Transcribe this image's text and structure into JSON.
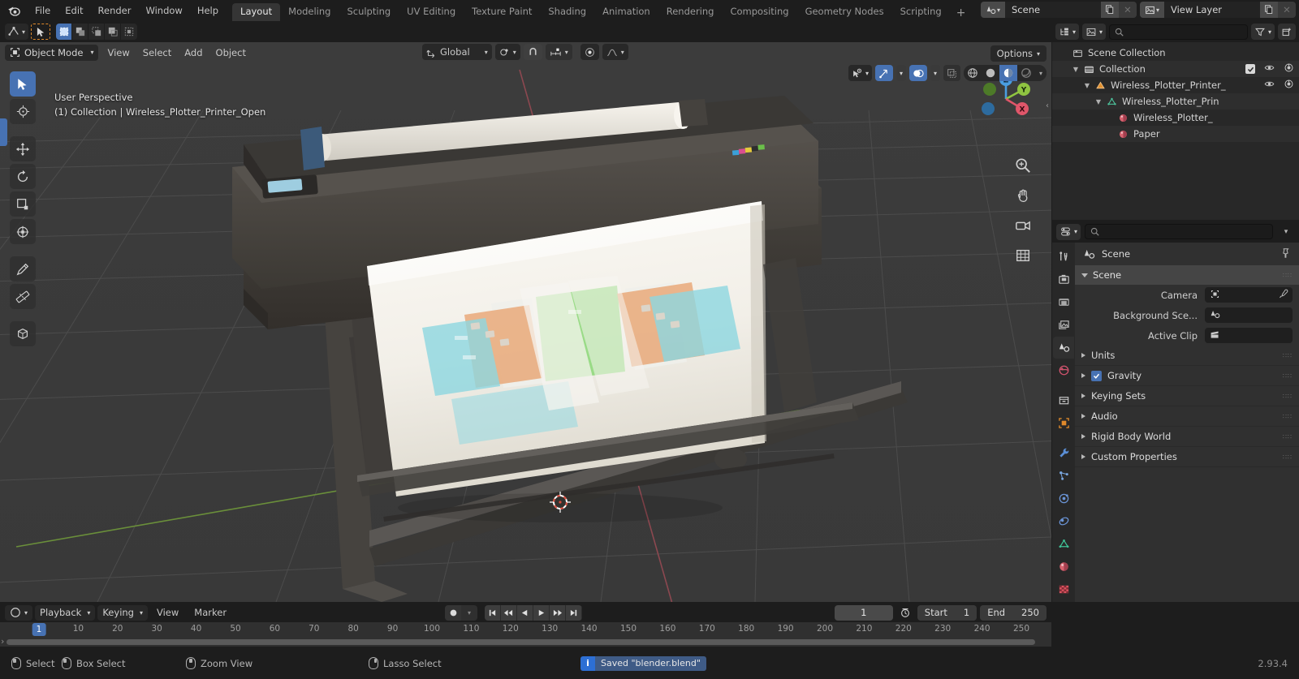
{
  "app": {
    "version": "2.93.4",
    "accent_blue": "#4772b3",
    "accent_orange": "#e08a2b"
  },
  "topbar": {
    "logo_icon": "blender-logo-icon",
    "menus": [
      "File",
      "Edit",
      "Render",
      "Window",
      "Help"
    ],
    "workspaces": [
      {
        "label": "Layout",
        "active": true
      },
      {
        "label": "Modeling",
        "active": false
      },
      {
        "label": "Sculpting",
        "active": false
      },
      {
        "label": "UV Editing",
        "active": false
      },
      {
        "label": "Texture Paint",
        "active": false
      },
      {
        "label": "Shading",
        "active": false
      },
      {
        "label": "Animation",
        "active": false
      },
      {
        "label": "Rendering",
        "active": false
      },
      {
        "label": "Compositing",
        "active": false
      },
      {
        "label": "Geometry Nodes",
        "active": false
      },
      {
        "label": "Scripting",
        "active": false
      }
    ],
    "add_workspace_label": "+",
    "scene_selector": {
      "icon": "scene-icon",
      "value": "Scene",
      "new_icon": "duplicate-icon",
      "unlink_icon": "x-icon"
    },
    "viewlayer_selector": {
      "icon": "view-layer-icon",
      "value": "View Layer",
      "new_icon": "duplicate-icon",
      "unlink_icon": "x-icon"
    }
  },
  "viewport": {
    "header": {
      "editor_type_icon": "editor-type-icon",
      "cursor_tool_icon": "cursor-icon",
      "select_modes": [
        "select-box-icon",
        "select-extend-icon",
        "select-subtract-icon",
        "select-invert-icon",
        "select-intersect-icon"
      ],
      "mode_label": "Object Mode",
      "mode_icon": "object-mode-icon",
      "menus": [
        "View",
        "Select",
        "Add",
        "Object"
      ],
      "transform_orientation": {
        "icon": "orientation-icon",
        "value": "Global"
      },
      "pivot_icon": "pivot-icon",
      "snap_icon": "snap-magnet-icon",
      "snap_to_icon": "snap-increment-icon",
      "proportional_icon": "proportional-edit-icon",
      "falloff_icon": "falloff-curve-icon",
      "options_label": "Options",
      "visibility_icon": "object-types-visibility-icon",
      "gizmo_icon": "gizmo-icon",
      "overlays_icon": "overlays-icon",
      "xray_icon": "xray-icon",
      "shading_modes": [
        "wireframe-icon",
        "solid-icon",
        "material-preview-icon",
        "rendered-icon"
      ],
      "active_shading_index": 2
    },
    "info_line1": "User Perspective",
    "info_line2": "(1) Collection | Wireless_Plotter_Printer_Open",
    "toolbar": [
      {
        "name": "tweak-select-tool",
        "icon": "cursor-arrow-icon",
        "active": true
      },
      {
        "name": "cursor-tool",
        "icon": "3d-cursor-icon",
        "active": false
      },
      {
        "name": "move-tool",
        "icon": "move-arrows-icon",
        "active": false
      },
      {
        "name": "rotate-tool",
        "icon": "rotate-icon",
        "active": false
      },
      {
        "name": "scale-tool",
        "icon": "scale-icon",
        "active": false
      },
      {
        "name": "transform-tool",
        "icon": "transform-icon",
        "active": false
      },
      {
        "name": "annotate-tool",
        "icon": "pencil-icon",
        "active": false
      },
      {
        "name": "measure-tool",
        "icon": "ruler-icon",
        "active": false
      },
      {
        "name": "add-cube-tool",
        "icon": "add-cube-icon",
        "active": false
      }
    ],
    "nav_gizmo": {
      "axes": [
        {
          "label": "Z",
          "color": "#4a9de0"
        },
        {
          "label": "Y",
          "color": "#8fc441"
        },
        {
          "label": "X",
          "color": "#e0566a"
        }
      ]
    },
    "nav_icons": [
      "zoom-icon",
      "hand-pan-icon",
      "camera-view-icon",
      "toggle-ortho-icon"
    ],
    "scene_object": "Wireless Plotter Printer (large format plotter with printed floor plan on paper roll)"
  },
  "outliner": {
    "header": {
      "display_mode_icon": "outliner-display-mode-icon",
      "filter_id_icon": "id-type-filter-icon",
      "search_icon": "search-icon",
      "search_placeholder": "",
      "filter_icon": "funnel-filter-icon",
      "new_collection_icon": "new-collection-icon"
    },
    "rows": [
      {
        "label": "Scene Collection",
        "icon": "scene-collection-icon",
        "indent": 0,
        "disclosure": "",
        "restrict": []
      },
      {
        "label": "Collection",
        "icon": "collection-icon",
        "indent": 1,
        "disclosure": "down",
        "restrict": [
          "checkbox-on",
          "eye-icon",
          "camera-icon"
        ]
      },
      {
        "label": "Wireless_Plotter_Printer_",
        "icon": "object-mesh-icon",
        "indent": 2,
        "disclosure": "down",
        "restrict": [
          "eye-icon",
          "camera-icon"
        ]
      },
      {
        "label": "Wireless_Plotter_Prin",
        "icon": "mesh-data-icon",
        "indent": 3,
        "disclosure": "down",
        "restrict": []
      },
      {
        "label": "Wireless_Plotter_",
        "icon": "material-icon",
        "indent": 4,
        "disclosure": "",
        "restrict": []
      },
      {
        "label": "Paper",
        "icon": "material-icon",
        "indent": 4,
        "disclosure": "",
        "restrict": []
      }
    ]
  },
  "properties": {
    "header": {
      "editor_icon": "properties-editor-icon",
      "search_icon": "search-icon",
      "search_placeholder": "",
      "chevron_icon": "chevron-down-icon"
    },
    "tabs": [
      {
        "name": "tool",
        "icon": "tool-screwdriver-wrench-icon",
        "active": false
      },
      {
        "name": "render",
        "icon": "render-camera-back-icon",
        "active": false
      },
      {
        "name": "output",
        "icon": "output-printer-icon",
        "active": false
      },
      {
        "name": "view-layer",
        "icon": "view-layer-images-icon",
        "active": false
      },
      {
        "name": "scene",
        "icon": "scene-cone-icon",
        "active": true
      },
      {
        "name": "world",
        "icon": "world-globe-icon",
        "active": false
      },
      {
        "name": "collection",
        "icon": "collection-box-icon",
        "active": false
      },
      {
        "name": "object",
        "icon": "object-square-icon",
        "active": false
      },
      {
        "name": "modifiers",
        "icon": "wrench-icon",
        "active": false
      },
      {
        "name": "particles",
        "icon": "particles-icon",
        "active": false
      },
      {
        "name": "physics",
        "icon": "physics-orbit-icon",
        "active": false
      },
      {
        "name": "constraints",
        "icon": "constraints-icon",
        "active": false
      },
      {
        "name": "object-data",
        "icon": "mesh-data-triangle-icon",
        "active": false
      },
      {
        "name": "material",
        "icon": "material-sphere-icon",
        "active": false
      },
      {
        "name": "texture",
        "icon": "texture-checker-icon",
        "active": false
      }
    ],
    "breadcrumb": {
      "icon": "scene-cone-icon",
      "label": "Scene",
      "pin_icon": "pin-icon"
    },
    "scene_panel": {
      "title": "Scene",
      "fields": [
        {
          "label": "Camera",
          "value": "",
          "icon": "camera-data-icon",
          "eyedropper": true
        },
        {
          "label": "Background Sce...",
          "value": "",
          "icon": "scene-cone-icon",
          "eyedropper": false
        },
        {
          "label": "Active Clip",
          "value": "",
          "icon": "movie-clip-icon",
          "eyedropper": false
        }
      ]
    },
    "accordions": [
      {
        "label": "Units",
        "checkbox": null
      },
      {
        "label": "Gravity",
        "checkbox": true
      },
      {
        "label": "Keying Sets",
        "checkbox": null
      },
      {
        "label": "Audio",
        "checkbox": null
      },
      {
        "label": "Rigid Body World",
        "checkbox": null
      },
      {
        "label": "Custom Properties",
        "checkbox": null
      }
    ]
  },
  "timeline": {
    "editor_icon": "timeline-editor-icon",
    "menus": [
      "Playback",
      "Keying",
      "View",
      "Marker"
    ],
    "record_icons": [
      "auto-keying-record-icon",
      "keying-dropdown-icon"
    ],
    "playback_icons": [
      "jump-start-icon",
      "prev-keyframe-icon",
      "play-reverse-icon",
      "play-icon",
      "next-keyframe-icon",
      "jump-end-icon"
    ],
    "current_frame": "1",
    "sync_icon": "sync-clock-icon",
    "start_label": "Start",
    "start_value": "1",
    "end_label": "End",
    "end_value": "250",
    "ruler_ticks": [
      "10",
      "20",
      "30",
      "40",
      "50",
      "60",
      "70",
      "80",
      "90",
      "100",
      "110",
      "120",
      "130",
      "140",
      "150",
      "160",
      "170",
      "180",
      "190",
      "200",
      "210",
      "220",
      "230",
      "240",
      "250"
    ],
    "playhead_label": "1"
  },
  "statusbar": {
    "items": [
      {
        "icon": "mouse-left-icon",
        "label": "Select"
      },
      {
        "icon": "mouse-left-drag-icon",
        "label": "Box Select"
      },
      {
        "icon": "mouse-middle-icon",
        "label": "Zoom View"
      },
      {
        "icon": "mouse-right-icon",
        "label": "Lasso Select"
      }
    ],
    "notification": {
      "icon": "info-icon",
      "text": "Saved \"blender.blend\""
    },
    "version": "2.93.4"
  }
}
